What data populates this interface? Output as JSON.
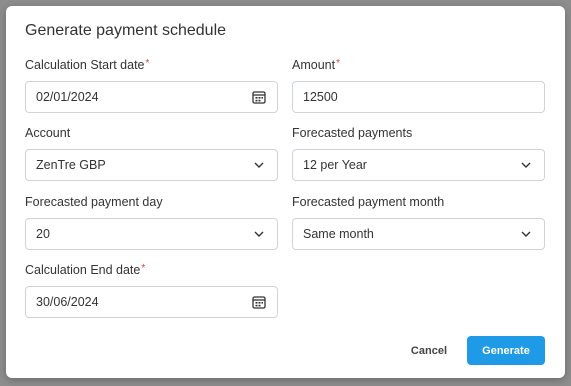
{
  "dialog": {
    "title": "Generate payment schedule",
    "required_marker": "*"
  },
  "fields": {
    "calc_start": {
      "label": "Calculation Start date",
      "value": "02/01/2024",
      "icon": "calendar-icon"
    },
    "amount": {
      "label": "Amount",
      "value": "12500"
    },
    "account": {
      "label": "Account",
      "value": "ZenTre GBP",
      "icon": "chevron-down-icon"
    },
    "forecasted_payments": {
      "label": "Forecasted payments",
      "value": "12 per Year",
      "icon": "chevron-down-icon"
    },
    "payment_day": {
      "label": "Forecasted payment day",
      "value": "20",
      "icon": "chevron-down-icon"
    },
    "payment_month": {
      "label": "Forecasted payment month",
      "value": "Same month",
      "icon": "chevron-down-icon"
    },
    "calc_end": {
      "label": "Calculation End date",
      "value": "30/06/2024",
      "icon": "calendar-icon"
    }
  },
  "actions": {
    "cancel_label": "Cancel",
    "generate_label": "Generate"
  },
  "colors": {
    "primary": "#1f9ae6",
    "required": "#e53935",
    "backdrop": "#8d8d8d"
  }
}
